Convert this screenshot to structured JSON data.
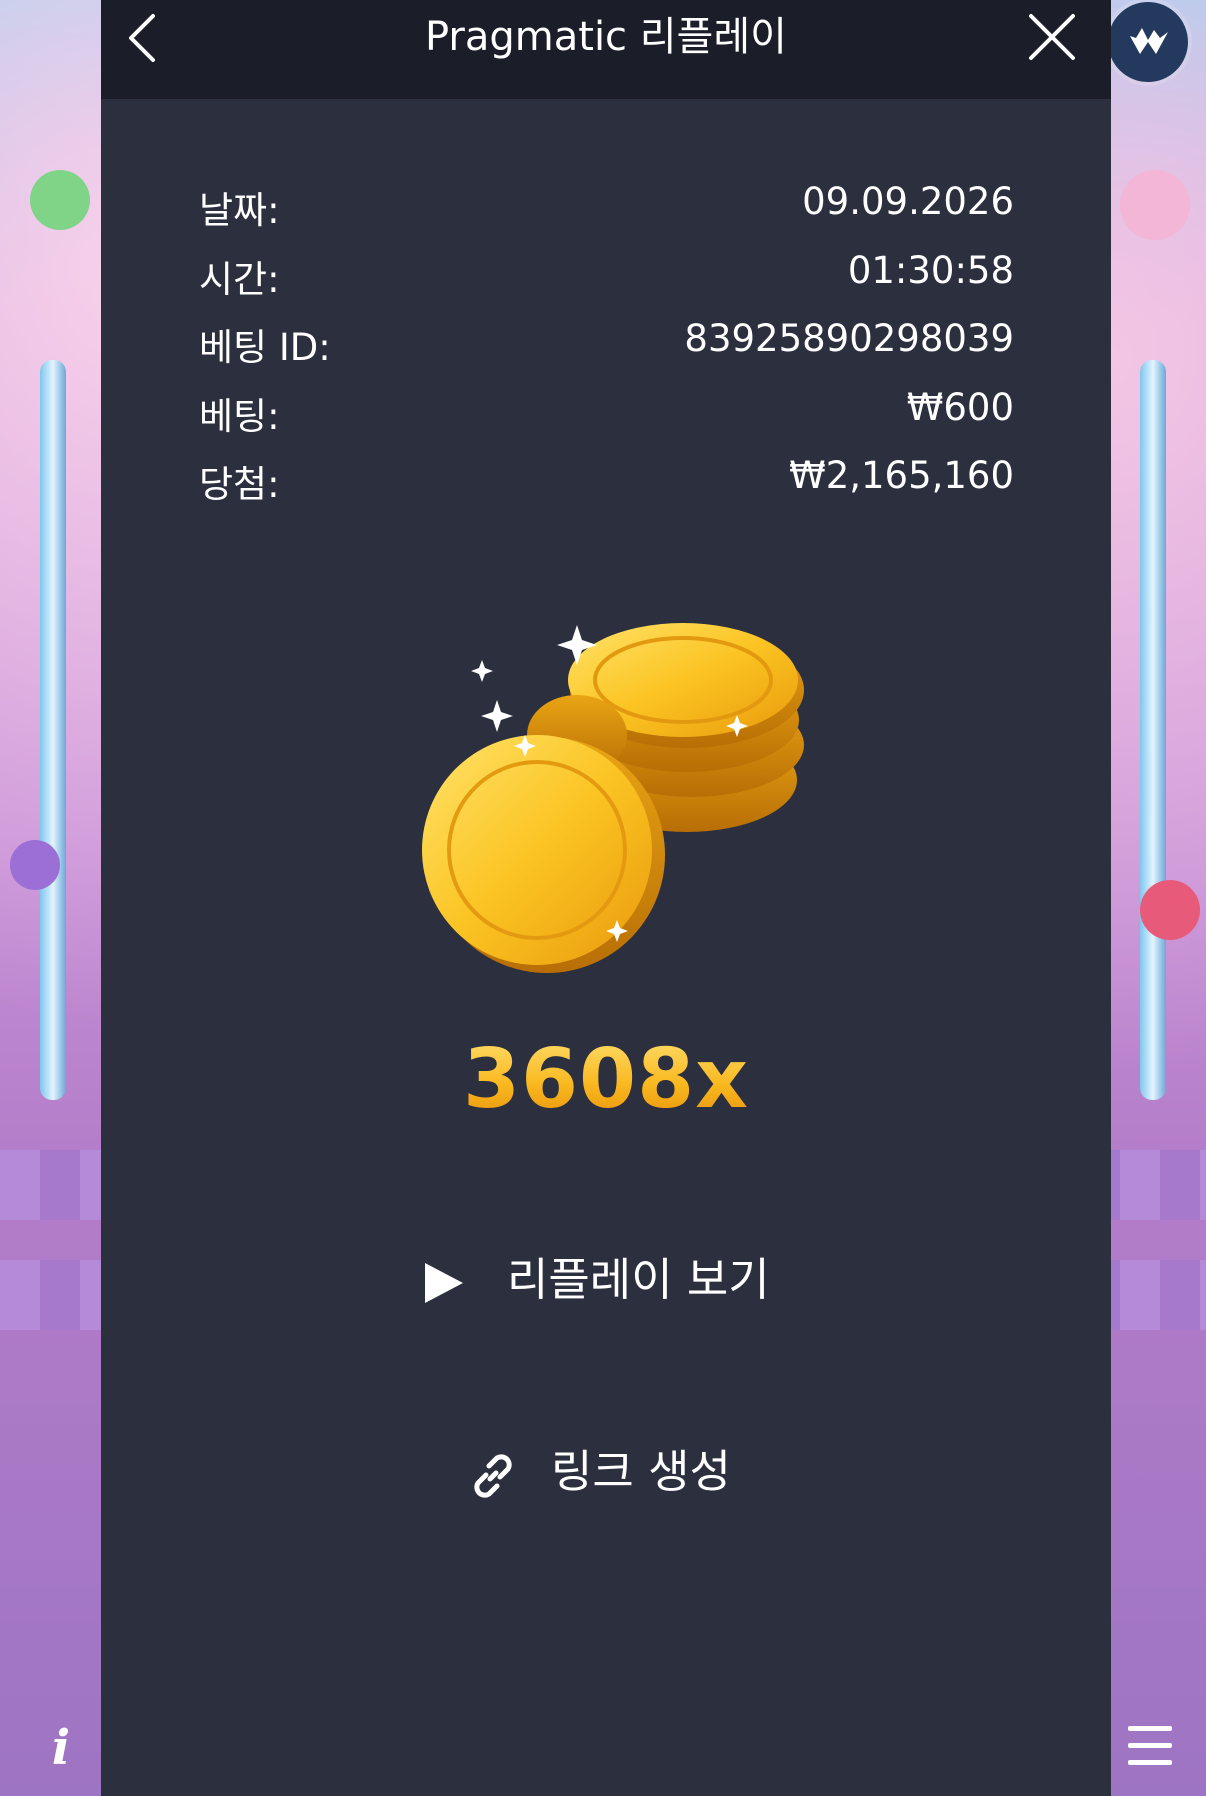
{
  "header": {
    "title": "Pragmatic 리플레이"
  },
  "bet_info": {
    "rows": [
      {
        "label": "날짜:",
        "value": "09.09.2026"
      },
      {
        "label": "시간:",
        "value": "01:30:58"
      },
      {
        "label": "베팅 ID:",
        "value": "83925890298039"
      },
      {
        "label": "베팅:",
        "value": "₩600"
      },
      {
        "label": "당첨:",
        "value": "₩2,165,160"
      }
    ]
  },
  "result": {
    "multiplier": "3608x"
  },
  "actions": {
    "replay_label": "리플레이 보기",
    "link_label": "링크 생성"
  },
  "side_controls": {
    "info_label": "i"
  },
  "icons": {
    "back": "chevron-left-icon",
    "close": "close-icon",
    "play": "play-icon",
    "link": "link-icon",
    "coins": "gold-coins-icon",
    "logo": "pragmatic-logo-icon",
    "menu": "hamburger-menu-icon"
  },
  "colors": {
    "header_bg": "#1b1d29",
    "panel_bg": "#2c2f3e",
    "multiplier_gold": "#f7b21b"
  }
}
